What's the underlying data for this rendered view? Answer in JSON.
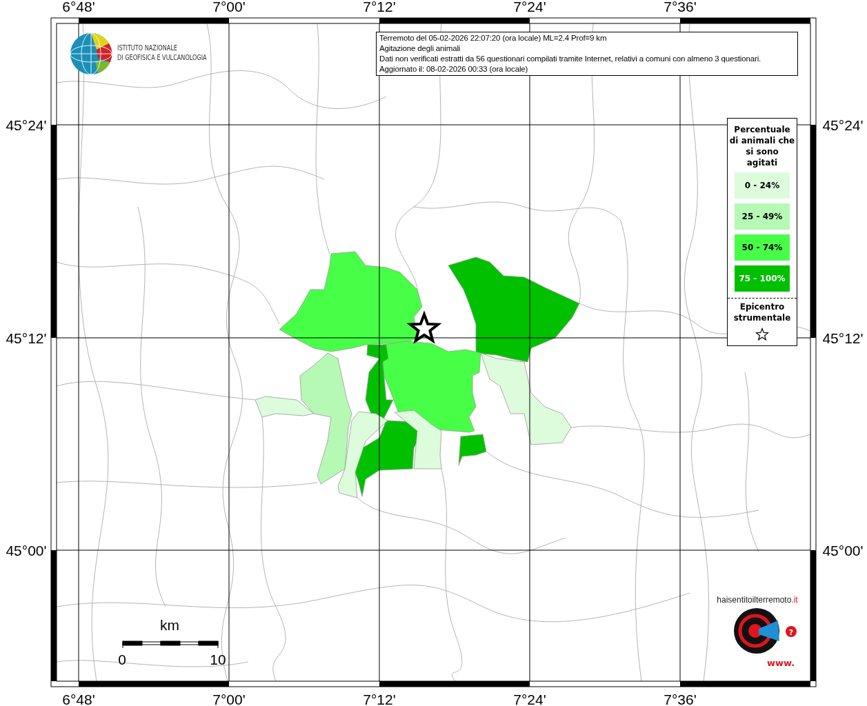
{
  "map": {
    "lon_labels_top": [
      "6°48'",
      "7°00'",
      "7°12'",
      "7°24'",
      "7°36'"
    ],
    "lon_labels_bottom": [
      "6°48'",
      "7°00'",
      "7°12'",
      "7°24'",
      "7°36'"
    ],
    "lat_labels_left": [
      "45°24'",
      "45°12'",
      "45°00'"
    ],
    "lat_labels_right": [
      "45°24'",
      "45°12'",
      "45°00'"
    ],
    "regions": [
      {
        "color": "#47ff47"
      },
      {
        "color": "#00c000"
      },
      {
        "color": "#47ff47"
      },
      {
        "color": "#00c000"
      },
      {
        "color": "#00c000"
      },
      {
        "color": "#00c000"
      },
      {
        "color": "#b5f9b5"
      },
      {
        "color": "#dcfcdc"
      },
      {
        "color": "#dcfcdc"
      },
      {
        "color": "#dcfcdc"
      },
      {
        "color": "#dcfcdc"
      }
    ],
    "scale": {
      "unit": "km",
      "start": "0",
      "end": "10"
    }
  },
  "institute": {
    "line1": "ISTITUTO NAZIONALE",
    "line2": "DI GEOFISICA E VULCANOLOGIA"
  },
  "info_box": [
    "Terremoto del 05-02-2026 22:07:20 (ora locale) ML=2.4 Prof=9 km",
    "Agitazione degli animali",
    "Dati non verificati estratti da 56 questionari compilati tramite Internet, relativi a comuni con almeno 3 questionari.",
    "Aggiornato il: 08-02-2026 00:33 (ora locale)"
  ],
  "legend": {
    "title": "Percentuale di animali che si sono agitati",
    "classes": [
      {
        "label": "0 - 24%",
        "color": "#dcfcdc"
      },
      {
        "label": "25 - 49%",
        "color": "#b5f9b5"
      },
      {
        "label": "50 - 74%",
        "color": "#47ff47"
      },
      {
        "label": "75 - 100%",
        "color": "#00c000"
      }
    ],
    "epicenter_label": "Epicentro strumentale"
  },
  "site_logo": {
    "prefix": "www.",
    "name": "haisentitoilterremoto",
    "suffix": ".it",
    "mark": "?"
  }
}
